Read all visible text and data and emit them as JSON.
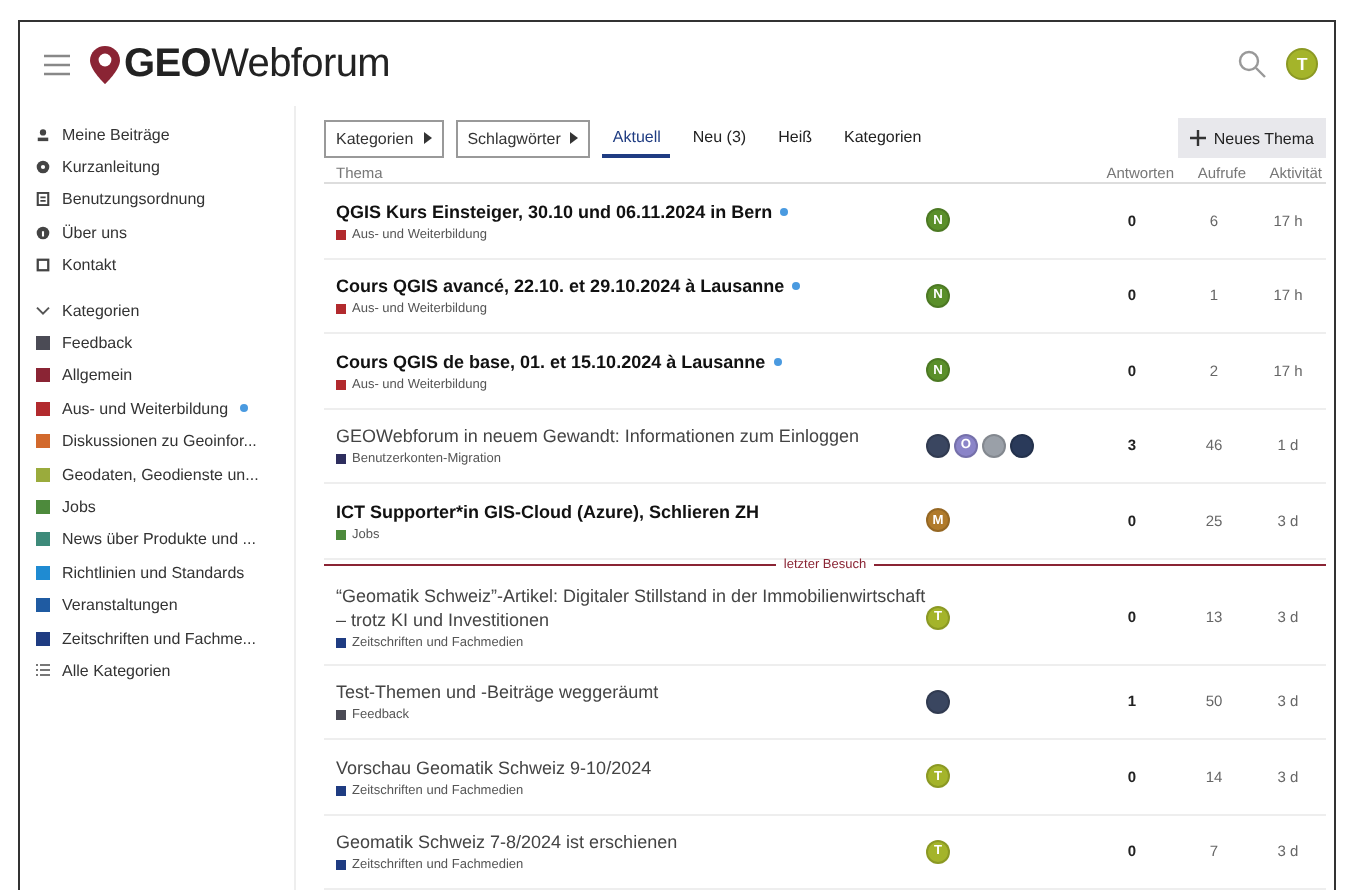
{
  "header": {
    "logo": "**GEO**Webforum",
    "user_avatar": {
      "letter": "T",
      "color": "#a4b42a"
    }
  },
  "sidebar": {
    "links": [
      {
        "label": "Meine Beiträge"
      },
      {
        "label": "Kurzanleitung"
      },
      {
        "label": "Benutzungsordnung"
      },
      {
        "label": "Über uns"
      },
      {
        "label": "Kontakt"
      }
    ],
    "section": {
      "label": "Kategorien",
      "expanded": true
    },
    "categories": [
      {
        "label": "Feedback",
        "color": "#4b4b55",
        "new": false
      },
      {
        "label": "Allgemein",
        "color": "#8a2434",
        "new": false
      },
      {
        "label": "Aus- und Weiterbildung",
        "color": "#b22a2e",
        "new": true
      },
      {
        "label": "Diskussionen zu Geoinfor...",
        "color": "#d2692c",
        "new": false
      },
      {
        "label": "Geodaten, Geodienste un...",
        "color": "#9aab3c",
        "new": false
      },
      {
        "label": "Jobs",
        "color": "#4d8a3c",
        "new": false
      },
      {
        "label": "News über Produkte und ...",
        "color": "#3d8a7a",
        "new": false
      },
      {
        "label": "Richtlinien und Standards",
        "color": "#1f8bd2",
        "new": false
      },
      {
        "label": "Veranstaltungen",
        "color": "#1f5ba2",
        "new": false
      },
      {
        "label": "Zeitschriften und Fachme...",
        "color": "#1f3c82",
        "new": false
      }
    ],
    "all_categories": "Alle Kategorien"
  },
  "nav": {
    "dropdowns": [
      "Kategorien",
      "Schlagwörter"
    ],
    "tabs": [
      {
        "label": "Aktuell",
        "selected": true
      },
      {
        "label": "Neu (3)",
        "selected": false
      },
      {
        "label": "Heiß",
        "selected": false
      },
      {
        "label": "Kategorien",
        "selected": false
      }
    ],
    "new_topic_button": "Neues Thema"
  },
  "table": {
    "columns": [
      "Thema",
      "Antworten",
      "Aufrufe",
      "Aktivität"
    ],
    "rows": [
      {
        "kind": "topic",
        "title": "QGIS Kurs Einsteiger, 30.10 und 06.11.2024 in Bern",
        "unread": true,
        "new": true,
        "category": {
          "label": "Aus- und Weiterbildung",
          "color": "#b22a2e"
        },
        "posters": [
          {
            "kind": "letter",
            "letter": "N",
            "color": "#5a8f2a"
          }
        ],
        "replies": "0",
        "views": "6",
        "activity": "17 h"
      },
      {
        "kind": "topic",
        "title": "Cours QGIS avancé, 22.10. et 29.10.2024 à Lausanne",
        "unread": true,
        "new": true,
        "category": {
          "label": "Aus- und Weiterbildung",
          "color": "#b22a2e"
        },
        "posters": [
          {
            "kind": "letter",
            "letter": "N",
            "color": "#5a8f2a"
          }
        ],
        "replies": "0",
        "views": "1",
        "activity": "17 h"
      },
      {
        "kind": "topic",
        "title": "Cours QGIS de base, 01. et 15.10.2024 à Lausanne",
        "unread": true,
        "new": true,
        "category": {
          "label": "Aus- und Weiterbildung",
          "color": "#b22a2e"
        },
        "posters": [
          {
            "kind": "letter",
            "letter": "N",
            "color": "#5a8f2a"
          }
        ],
        "replies": "0",
        "views": "2",
        "activity": "17 h"
      },
      {
        "kind": "topic",
        "title": "GEOWebforum in neuem Gewandt: Informationen zum Einloggen",
        "unread": false,
        "new": false,
        "category": {
          "label": "Benutzerkonten-Migration",
          "color": "#2e2e5e"
        },
        "posters": [
          {
            "kind": "photo",
            "color": "#3a4660"
          },
          {
            "kind": "letter",
            "letter": "O",
            "color": "#8a84c8"
          },
          {
            "kind": "photo",
            "color": "#9aa0a8"
          },
          {
            "kind": "photo",
            "color": "#2a3a5a"
          }
        ],
        "replies": "3",
        "views": "46",
        "activity": "1 d"
      },
      {
        "kind": "topic",
        "title": "ICT Supporter*in GIS-Cloud (Azure), Schlieren ZH",
        "unread": true,
        "new": false,
        "category": {
          "label": "Jobs",
          "color": "#4d8a3c"
        },
        "posters": [
          {
            "kind": "letter",
            "letter": "M",
            "color": "#b07a2a"
          }
        ],
        "replies": "0",
        "views": "25",
        "activity": "3 d"
      },
      {
        "kind": "divider",
        "label": "letzter Besuch"
      },
      {
        "kind": "topic",
        "title": "“Geomatik Schweiz”-Artikel: Digitaler Stillstand in der Immobilienwirtschaft – trotz KI und Investitionen",
        "unread": false,
        "new": false,
        "category": {
          "label": "Zeitschriften und Fachmedien",
          "color": "#1f3c82"
        },
        "posters": [
          {
            "kind": "letter",
            "letter": "T",
            "color": "#a4b42a"
          }
        ],
        "replies": "0",
        "views": "13",
        "activity": "3 d"
      },
      {
        "kind": "topic",
        "title": "Test-Themen und -Beiträge weggeräumt",
        "unread": false,
        "new": false,
        "category": {
          "label": "Feedback",
          "color": "#4b4b55"
        },
        "posters": [
          {
            "kind": "photo",
            "color": "#3a4660"
          }
        ],
        "replies": "1",
        "views": "50",
        "activity": "3 d"
      },
      {
        "kind": "topic",
        "title": "Vorschau Geomatik Schweiz 9-10/2024",
        "unread": false,
        "new": false,
        "category": {
          "label": "Zeitschriften und Fachmedien",
          "color": "#1f3c82"
        },
        "posters": [
          {
            "kind": "letter",
            "letter": "T",
            "color": "#a4b42a"
          }
        ],
        "replies": "0",
        "views": "14",
        "activity": "3 d"
      },
      {
        "kind": "topic",
        "title": "Geomatik Schweiz 7-8/2024 ist erschienen",
        "unread": false,
        "new": false,
        "category": {
          "label": "Zeitschriften und Fachmedien",
          "color": "#1f3c82"
        },
        "posters": [
          {
            "kind": "letter",
            "letter": "T",
            "color": "#a4b42a"
          }
        ],
        "replies": "0",
        "views": "7",
        "activity": "3 d"
      }
    ]
  }
}
